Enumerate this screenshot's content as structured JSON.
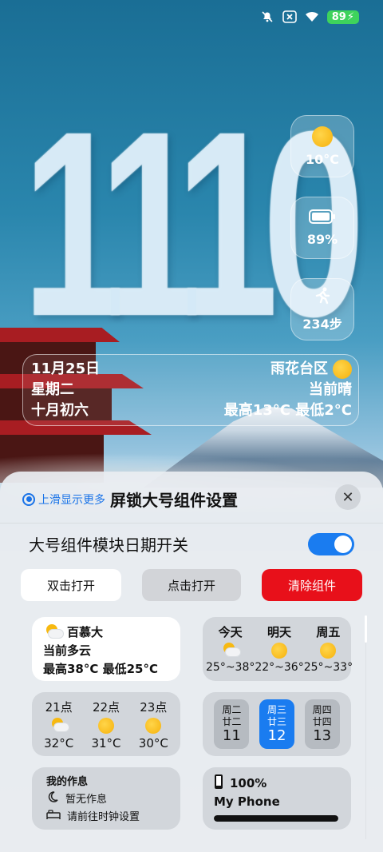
{
  "status_bar": {
    "icons": [
      "mute-icon",
      "close-box-icon",
      "wifi-icon"
    ],
    "battery": "89"
  },
  "clock": {
    "time": "1110"
  },
  "side_widgets": {
    "weather": {
      "icon": "sun-icon",
      "value": "10°C"
    },
    "battery": {
      "icon": "battery-icon",
      "value": "89%"
    },
    "steps": {
      "icon": "running-icon",
      "value": "234步"
    }
  },
  "date_strip": {
    "date": "11月25日",
    "weekday": "星期二",
    "lunar": "十月初六",
    "location": "雨花台区",
    "condition": "当前晴",
    "high_low": "最高13°C 最低2°C"
  },
  "sheet": {
    "hint": "上滑显示更多",
    "title": "屏锁大号组件设置",
    "toggle_label": "大号组件模块日期开关",
    "toggle_on": true,
    "buttons": {
      "double_click": "双击打开",
      "click": "点击打开",
      "clear": "清除组件"
    },
    "widgets": {
      "weather_now": {
        "place": "百慕大",
        "condition": "当前多云",
        "high_low": "最高38°C 最低25°C"
      },
      "forecast": [
        {
          "day": "今天",
          "icon": "cloud-sun-icon",
          "range": "25°~38°"
        },
        {
          "day": "明天",
          "icon": "sun-icon",
          "range": "22°~36°"
        },
        {
          "day": "周五",
          "icon": "sun-icon",
          "range": "25°~33°"
        }
      ],
      "hourly": [
        {
          "hour": "21点",
          "icon": "cloud-sun-icon",
          "temp": "32°C"
        },
        {
          "hour": "22点",
          "icon": "sun-icon",
          "temp": "31°C"
        },
        {
          "hour": "23点",
          "icon": "sun-icon",
          "temp": "30°C"
        }
      ],
      "calendar": [
        {
          "weekday": "周二",
          "lunar": "廿二",
          "day": "11",
          "selected": false
        },
        {
          "weekday": "周三",
          "lunar": "廿三",
          "day": "12",
          "selected": true
        },
        {
          "weekday": "周四",
          "lunar": "廿四",
          "day": "13",
          "selected": false
        }
      ],
      "schedule": {
        "title": "我的作息",
        "line1": "暂无作息",
        "line2": "请前往时钟设置"
      },
      "device": {
        "percent": "100%",
        "name": "My Phone",
        "level": 1.0
      }
    }
  }
}
